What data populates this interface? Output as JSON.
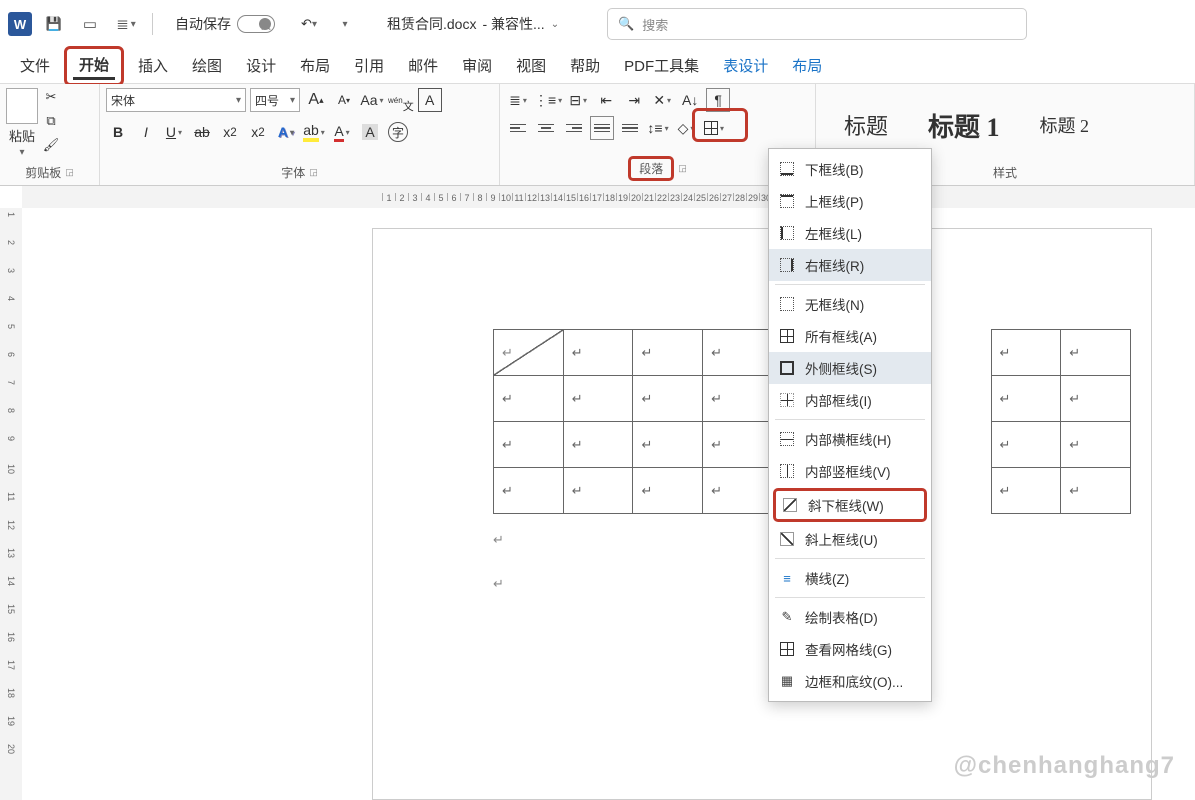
{
  "titlebar": {
    "autosave_label": "自动保存",
    "autosave_state": "关",
    "doc_name": "租赁合同.docx",
    "compat": "- 兼容性...",
    "search_placeholder": "搜索"
  },
  "tabs": {
    "file": "文件",
    "home": "开始",
    "insert": "插入",
    "draw": "绘图",
    "design": "设计",
    "layout": "布局",
    "references": "引用",
    "mailings": "邮件",
    "review": "审阅",
    "view": "视图",
    "help": "帮助",
    "pdf": "PDF工具集",
    "table_design": "表设计",
    "table_layout": "布局"
  },
  "ribbon": {
    "paste": "粘贴",
    "clipboard": "剪贴板",
    "font_name": "宋体",
    "font_size": "四号",
    "font_group": "字体",
    "para_group": "段落",
    "styles_group": "样式",
    "style_normal": "标题",
    "style_h1": "标题 1",
    "style_h2": "标题 2"
  },
  "border_menu": {
    "bottom": "下框线(B)",
    "top": "上框线(P)",
    "left": "左框线(L)",
    "right": "右框线(R)",
    "none": "无框线(N)",
    "all": "所有框线(A)",
    "outside": "外侧框线(S)",
    "inside": "内部框线(I)",
    "inside_h": "内部横框线(H)",
    "inside_v": "内部竖框线(V)",
    "diag_down": "斜下框线(W)",
    "diag_up": "斜上框线(U)",
    "hline": "横线(Z)",
    "draw_table": "绘制表格(D)",
    "view_grid": "查看网格线(G)",
    "borders_shading": "边框和底纹(O)..."
  },
  "watermark": "@chenhanghang7"
}
